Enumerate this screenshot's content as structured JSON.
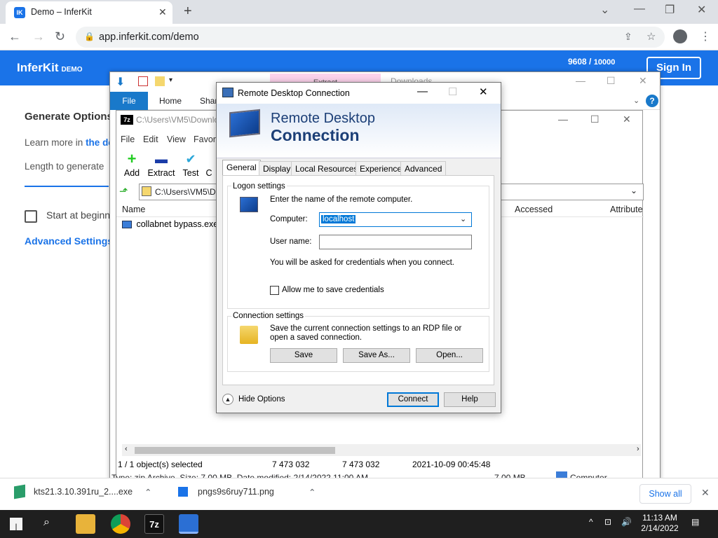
{
  "browser": {
    "tab_title": "Demo – InferKit",
    "tab_favicon": "IK",
    "url": "app.inferkit.com/demo"
  },
  "page": {
    "brand": "InferKit",
    "brand_tag": "DEMO",
    "count_value": "9608",
    "count_total": "10000",
    "signin": "Sign In",
    "generate_options": "Generate Options",
    "learn_more": "Learn more in",
    "learn_link": "the do",
    "length_label": "Length to generate",
    "start_at": "Start at beginn",
    "advanced_settings": "Advanced Settings »"
  },
  "zip": {
    "qat_tab_extract": "Extract",
    "qat_tab_downloads": "Downloads",
    "ribbon": [
      "File",
      "Home",
      "Shar"
    ],
    "title_path": "C:\\Users\\VM5\\Downlo",
    "menu": [
      "File",
      "Edit",
      "View",
      "Favori"
    ],
    "tools": [
      {
        "label": "Add",
        "icon": "+"
      },
      {
        "label": "Extract",
        "icon": "▬"
      },
      {
        "label": "Test",
        "icon": "✔"
      },
      {
        "label": "C",
        "icon": ""
      }
    ],
    "address": "C:\\Users\\VM5\\D",
    "columns": {
      "name": "Name",
      "accessed": "Accessed",
      "attributes": "Attribute"
    },
    "row_name": "collabnet bypass.exe",
    "status": {
      "selected": "1 / 1 object(s) selected",
      "size": "7 473 032",
      "packed": "7 473 032",
      "modified": "2021-10-09 00:45:48"
    },
    "explorer_status": "Type: zip Archive, Size: 7.00 MB, Date modified: 2/14/2022 11:00 AM",
    "explorer_size": "7.00 MB",
    "explorer_location": "Computer"
  },
  "rdp": {
    "title": "Remote Desktop Connection",
    "banner_line1": "Remote Desktop",
    "banner_line2": "Connection",
    "tabs": [
      "General",
      "Display",
      "Local Resources",
      "Experience",
      "Advanced"
    ],
    "logon_group": "Logon settings",
    "enter_name": "Enter the name of the remote computer.",
    "computer_label": "Computer:",
    "computer_value": "localhost",
    "username_label": "User name:",
    "username_value": "",
    "credentials_note": "You will be asked for credentials when you connect.",
    "allow_save": "Allow me to save credentials",
    "connection_group": "Connection settings",
    "connection_desc": "Save the current connection settings to an RDP file or open a saved connection.",
    "save": "Save",
    "save_as": "Save As...",
    "open": "Open...",
    "hide_options": "Hide Options",
    "connect": "Connect",
    "help": "Help"
  },
  "downloads": {
    "item1": "kts21.3.10.391ru_2....exe",
    "item2": "pngs9s6ruy711.png",
    "show_all": "Show all"
  },
  "taskbar": {
    "time": "11:13 AM",
    "date": "2/14/2022"
  }
}
